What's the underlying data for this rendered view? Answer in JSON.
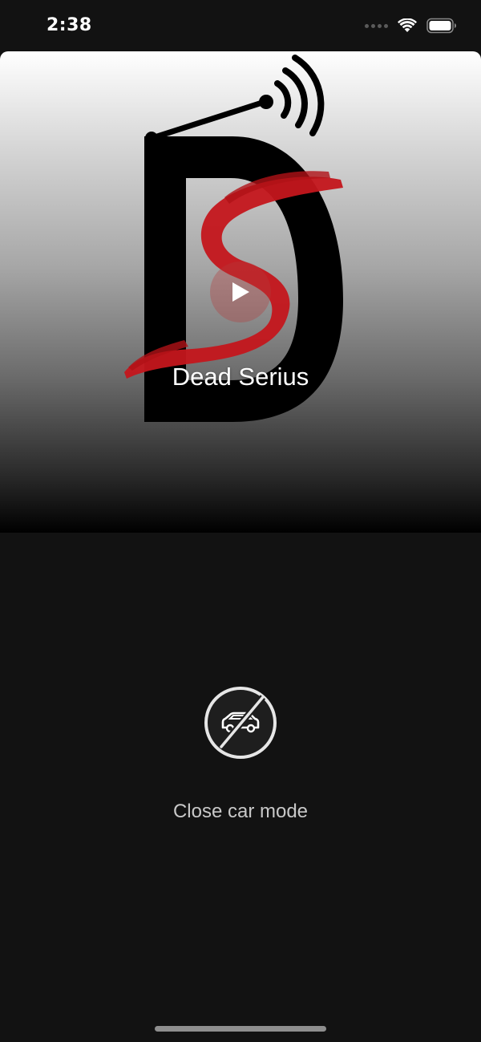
{
  "status_bar": {
    "time": "2:38"
  },
  "player": {
    "station_name": "Dead Serius"
  },
  "car_mode": {
    "close_label": "Close car mode"
  },
  "icons": {
    "play": "play-icon",
    "car_mode_off": "car-off-icon",
    "wifi": "wifi-icon",
    "battery": "battery-icon"
  },
  "colors": {
    "background": "#121212",
    "logo_red": "#c4161c",
    "label_gray": "#c8c8c8"
  }
}
